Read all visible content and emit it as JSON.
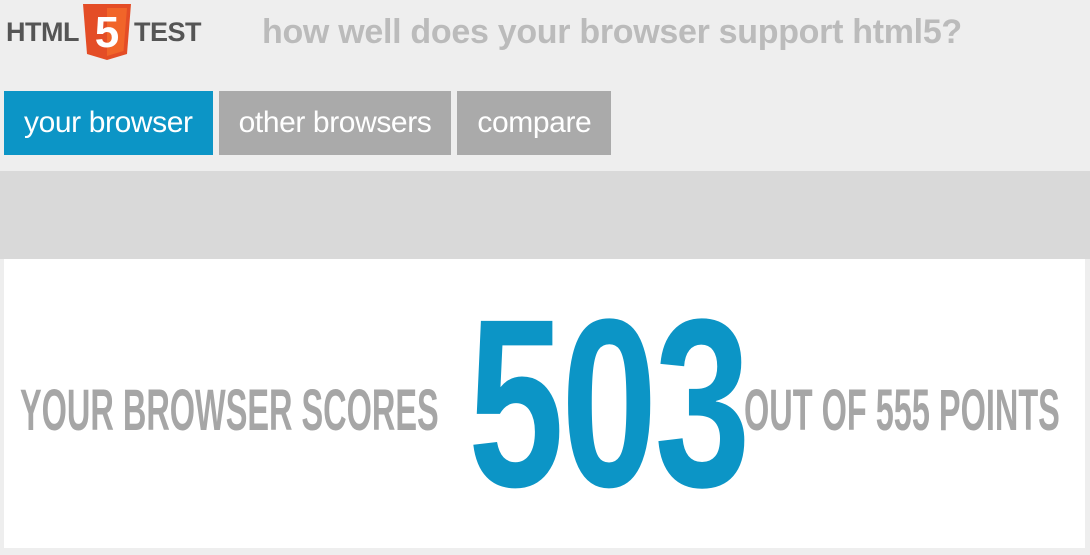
{
  "header": {
    "logo_left": "HTML",
    "logo_badge": "5",
    "logo_right": "TEST",
    "tagline": "how well does your browser support html5?"
  },
  "nav": {
    "tabs": [
      {
        "label": "your browser",
        "active": true
      },
      {
        "label": "other browsers",
        "active": false
      },
      {
        "label": "compare",
        "active": false
      }
    ]
  },
  "score": {
    "prefix": "YOUR BROWSER SCORES",
    "value": "503",
    "suffix": "OUT OF 555 POINTS"
  },
  "colors": {
    "accent": "#0c95c6",
    "logo_orange": "#e44d26",
    "tab_inactive": "#aaaaaa",
    "muted_text": "#a6a6a6"
  }
}
